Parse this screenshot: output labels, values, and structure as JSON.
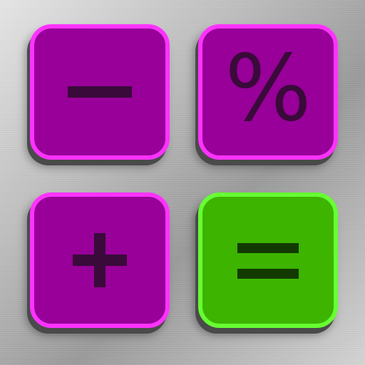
{
  "keys": [
    {
      "id": "minus",
      "label": "−",
      "icon": "minus-icon",
      "color": "#980099",
      "border": "#ff33ff"
    },
    {
      "id": "percent",
      "label": "%",
      "icon": "percent-icon",
      "color": "#980099",
      "border": "#ff33ff"
    },
    {
      "id": "plus",
      "label": "+",
      "icon": "plus-icon",
      "color": "#980099",
      "border": "#ff33ff"
    },
    {
      "id": "equals",
      "label": "=",
      "icon": "equals-icon",
      "color": "#3cb400",
      "border": "#66ff33"
    }
  ]
}
